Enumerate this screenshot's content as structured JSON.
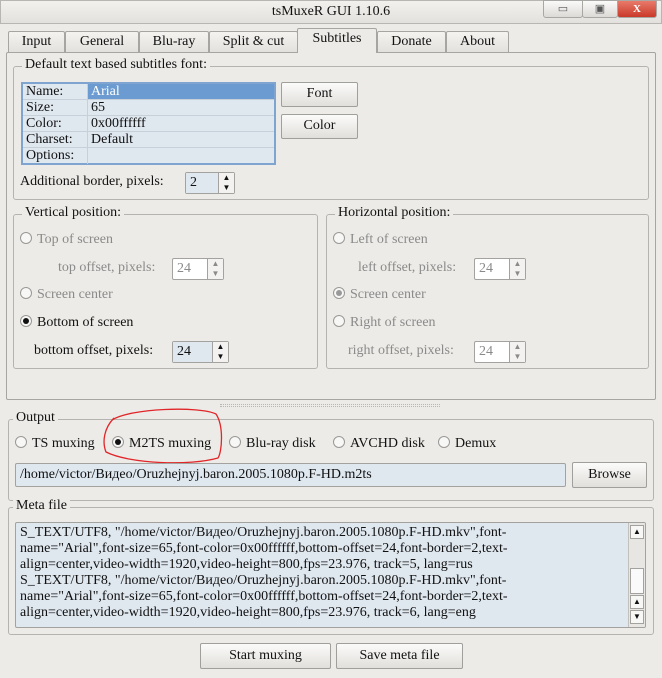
{
  "window": {
    "title": "tsMuxeR GUI 1.10.6",
    "minimize": "▭",
    "maximize": "▣",
    "close": "X"
  },
  "tabs": [
    {
      "label": "Input"
    },
    {
      "label": "General"
    },
    {
      "label": "Blu-ray"
    },
    {
      "label": "Split & cut"
    },
    {
      "label": "Subtitles"
    },
    {
      "label": "Donate"
    },
    {
      "label": "About"
    }
  ],
  "font_group": {
    "title": "Default text based subtitles font:",
    "rows": [
      {
        "key": "Name:",
        "value": "Arial"
      },
      {
        "key": "Size:",
        "value": "65"
      },
      {
        "key": "Color:",
        "value": "0x00ffffff"
      },
      {
        "key": "Charset:",
        "value": "Default"
      },
      {
        "key": "Options:",
        "value": ""
      }
    ],
    "font_button": "Font",
    "color_button": "Color",
    "border_label": "Additional border, pixels:",
    "border_value": "2"
  },
  "vertical": {
    "title": "Vertical position:",
    "top": "Top of screen",
    "top_offset_label": "top offset, pixels:",
    "top_offset": "24",
    "center": "Screen center",
    "bottom": "Bottom of screen",
    "bottom_offset_label": "bottom offset, pixels:",
    "bottom_offset": "24",
    "selected": "bottom"
  },
  "horizontal": {
    "title": "Horizontal position:",
    "left": "Left of screen",
    "left_offset_label": "left offset, pixels:",
    "left_offset": "24",
    "center": "Screen center",
    "right": "Right of screen",
    "right_offset_label": "right offset, pixels:",
    "right_offset": "24",
    "selected": "center"
  },
  "output": {
    "title": "Output",
    "options": [
      "TS muxing",
      "M2TS muxing",
      "Blu-ray disk",
      "AVCHD disk",
      "Demux"
    ],
    "selected": "M2TS muxing",
    "path": "/home/victor/Видео/Oruzhejnyj.baron.2005.1080p.F-HD.m2ts",
    "browse": "Browse"
  },
  "meta": {
    "title": "Meta file",
    "lines": [
      "S_TEXT/UTF8, \"/home/victor/Видео/Oruzhejnyj.baron.2005.1080p.F-HD.mkv\",font-",
      "name=\"Arial\",font-size=65,font-color=0x00ffffff,bottom-offset=24,font-border=2,text-",
      "align=center,video-width=1920,video-height=800,fps=23.976, track=5, lang=rus",
      "S_TEXT/UTF8, \"/home/victor/Видео/Oruzhejnyj.baron.2005.1080p.F-HD.mkv\",font-",
      "name=\"Arial\",font-size=65,font-color=0x00ffffff,bottom-offset=24,font-border=2,text-",
      "align=center,video-width=1920,video-height=800,fps=23.976, track=6, lang=eng"
    ]
  },
  "actions": {
    "start": "Start muxing",
    "save": "Save meta file"
  },
  "annotation_color": "#e0262a"
}
